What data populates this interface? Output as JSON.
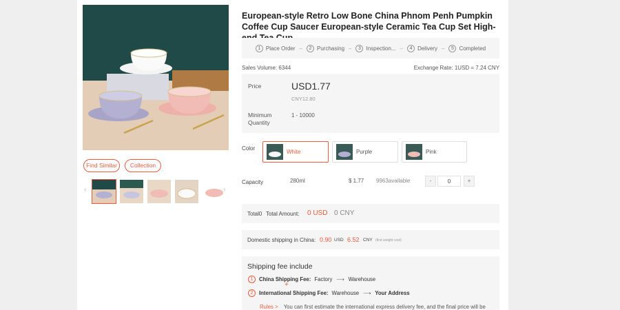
{
  "product": {
    "title": "European-style Retro Low Bone China Phnom Penh Pumpkin Coffee Cup Saucer European-style Ceramic Tea Cup Set High-end Tea Cup"
  },
  "actions": {
    "find_similar": "Find Similar",
    "collection": "Collection"
  },
  "steps": [
    {
      "num": "1",
      "label": "Place Order"
    },
    {
      "num": "2",
      "label": "Purchasing"
    },
    {
      "num": "3",
      "label": "Inspection..."
    },
    {
      "num": "4",
      "label": "Delivery"
    },
    {
      "num": "5",
      "label": "Completed"
    }
  ],
  "meta": {
    "sales_volume": "Sales Volume:  6344",
    "exchange_rate": "Exchange Rate: 1USD = 7.24 CNY"
  },
  "pricing": {
    "price_label": "Price",
    "price_usd": "USD1.77",
    "price_cny": "CNY12.80",
    "min_qty_label": "Minimum Quantity",
    "min_qty_range": "1 - 10000"
  },
  "color": {
    "label": "Color",
    "options": [
      {
        "name": "White",
        "selected": true
      },
      {
        "name": "Purple",
        "selected": false
      },
      {
        "name": "Pink",
        "selected": false
      }
    ]
  },
  "capacity": {
    "label": "Capacity",
    "value": "280ml",
    "price": "$ 1.77",
    "available": "9963available",
    "minus": "-",
    "plus": "+",
    "quantity": "0"
  },
  "total": {
    "label": "Total0",
    "amount_label": "Total Amount:",
    "usd": "0 USD",
    "cny": "0 CNY"
  },
  "domestic": {
    "label": "Domestic shipping in China:",
    "usd_value": "0.90",
    "usd_unit": "USD",
    "cny_value": "6.52",
    "cny_unit": "CNY",
    "note": "(first weight cost)"
  },
  "shipping": {
    "title": "Shipping fee include",
    "row1": {
      "num": "1",
      "label": "China Shipping Fee:",
      "from": "Factory",
      "to": "Warehouse"
    },
    "plus": "+",
    "row2": {
      "num": "2",
      "label": "International Shipping Fee:",
      "from": "Warehouse",
      "to": "Your Address"
    },
    "rules_link": "Rules >",
    "rules_text": "You can first estimate the international express delivery fee, and the final price will be"
  },
  "colors": {
    "accent": "#ea5a3c",
    "panel": "#f5f5f5"
  }
}
